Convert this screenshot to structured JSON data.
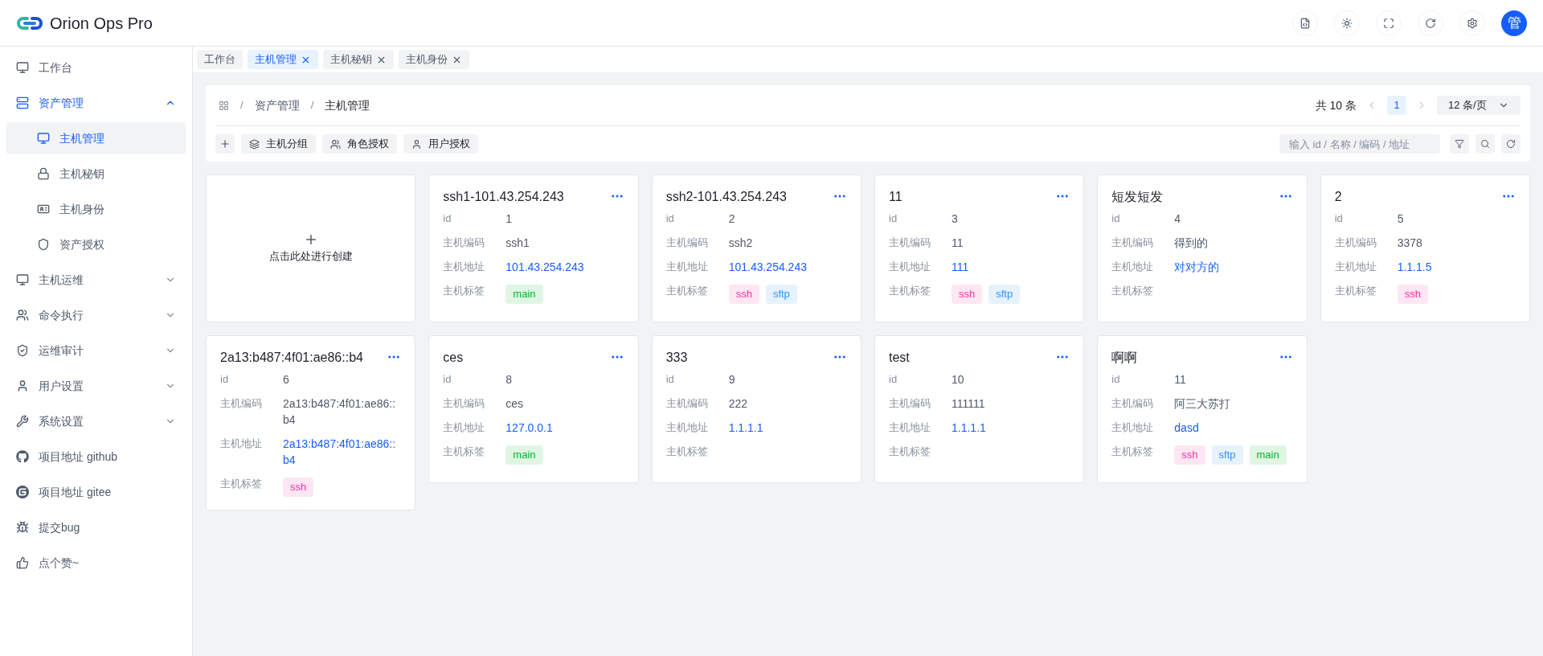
{
  "app": {
    "title": "Orion Ops Pro",
    "avatar": "管"
  },
  "sidebar": {
    "items": [
      {
        "label": "工作台",
        "selected": false
      },
      {
        "label": "资产管理",
        "selected": false,
        "expanded": true,
        "children": [
          {
            "label": "主机管理",
            "selected": true
          },
          {
            "label": "主机秘钥",
            "selected": false
          },
          {
            "label": "主机身份",
            "selected": false
          },
          {
            "label": "资产授权",
            "selected": false
          }
        ]
      },
      {
        "label": "主机运维",
        "selected": false,
        "expanded": false
      },
      {
        "label": "命令执行",
        "selected": false,
        "expanded": false
      },
      {
        "label": "运维审计",
        "selected": false,
        "expanded": false
      },
      {
        "label": "用户设置",
        "selected": false,
        "expanded": false
      },
      {
        "label": "系统设置",
        "selected": false,
        "expanded": false
      },
      {
        "label": "项目地址 github",
        "selected": false
      },
      {
        "label": "项目地址 gitee",
        "selected": false
      },
      {
        "label": "提交bug",
        "selected": false
      },
      {
        "label": "点个赞~",
        "selected": false
      }
    ]
  },
  "tabs": [
    {
      "label": "工作台",
      "selected": false,
      "closable": false
    },
    {
      "label": "主机管理",
      "selected": true,
      "closable": true
    },
    {
      "label": "主机秘钥",
      "selected": false,
      "closable": true
    },
    {
      "label": "主机身份",
      "selected": false,
      "closable": true
    }
  ],
  "breadcrumb": {
    "separator": "/",
    "items": [
      "资产管理",
      "主机管理"
    ]
  },
  "pagination": {
    "total": "共 10 条",
    "pages": [
      {
        "label": "1",
        "selected": true
      }
    ],
    "page_size": "12 条/页"
  },
  "toolbar": {
    "buttons": [
      "主机分组",
      "角色授权",
      "用户授权"
    ],
    "search": {
      "placeholder": "输入 id / 名称 / 编码 / 地址"
    }
  },
  "create_card": {
    "label": "点击此处进行创建"
  },
  "cards": [
    {
      "title": "ssh1-101.43.254.243",
      "fields": [
        {
          "kind": "text",
          "label": "id",
          "value": "1"
        },
        {
          "kind": "text",
          "label": "主机编码",
          "value": "ssh1"
        },
        {
          "kind": "link",
          "label": "主机地址",
          "value": "101.43.254.243"
        },
        {
          "kind": "tags",
          "label": "主机标签",
          "tags": [
            {
              "label": "main",
              "color": "#00b42a"
            }
          ]
        }
      ]
    },
    {
      "title": "ssh2-101.43.254.243",
      "fields": [
        {
          "kind": "text",
          "label": "id",
          "value": "2"
        },
        {
          "kind": "text",
          "label": "主机编码",
          "value": "ssh2"
        },
        {
          "kind": "link",
          "label": "主机地址",
          "value": "101.43.254.243"
        },
        {
          "kind": "tags",
          "label": "主机标签",
          "tags": [
            {
              "label": "ssh",
              "color": "#f5319d"
            },
            {
              "label": "sftp",
              "color": "#3491fa"
            }
          ]
        }
      ]
    },
    {
      "title": "11",
      "fields": [
        {
          "kind": "text",
          "label": "id",
          "value": "3"
        },
        {
          "kind": "text",
          "label": "主机编码",
          "value": "11"
        },
        {
          "kind": "link",
          "label": "主机地址",
          "value": "111"
        },
        {
          "kind": "tags",
          "label": "主机标签",
          "tags": [
            {
              "label": "ssh",
              "color": "#f5319d"
            },
            {
              "label": "sftp",
              "color": "#3491fa"
            }
          ]
        }
      ]
    },
    {
      "title": "短发短发",
      "fields": [
        {
          "kind": "text",
          "label": "id",
          "value": "4"
        },
        {
          "kind": "text",
          "label": "主机编码",
          "value": "得到的"
        },
        {
          "kind": "link",
          "label": "主机地址",
          "value": "对对方的"
        },
        {
          "kind": "tags",
          "label": "主机标签"
        }
      ]
    },
    {
      "title": "2",
      "fields": [
        {
          "kind": "text",
          "label": "id",
          "value": "5"
        },
        {
          "kind": "text",
          "label": "主机编码",
          "value": "3378"
        },
        {
          "kind": "link",
          "label": "主机地址",
          "value": "1.1.1.5"
        },
        {
          "kind": "tags",
          "label": "主机标签",
          "tags": [
            {
              "label": "ssh",
              "color": "#f5319d"
            }
          ]
        }
      ]
    },
    {
      "title": "2a13:b487:4f01:ae86::b4",
      "fields": [
        {
          "kind": "text",
          "label": "id",
          "value": "6"
        },
        {
          "kind": "text",
          "label": "主机编码",
          "value": "2a13:b487:4f01:ae86::b4"
        },
        {
          "kind": "link",
          "label": "主机地址",
          "value": "2a13:b487:4f01:ae86::b4"
        },
        {
          "kind": "tags",
          "label": "主机标签",
          "tags": [
            {
              "label": "ssh",
              "color": "#f5319d"
            }
          ]
        }
      ]
    },
    {
      "title": "ces",
      "fields": [
        {
          "kind": "text",
          "label": "id",
          "value": "8"
        },
        {
          "kind": "text",
          "label": "主机编码",
          "value": "ces"
        },
        {
          "kind": "link",
          "label": "主机地址",
          "value": "127.0.0.1"
        },
        {
          "kind": "tags",
          "label": "主机标签",
          "tags": [
            {
              "label": "main",
              "color": "#00b42a"
            }
          ]
        }
      ]
    },
    {
      "title": "333",
      "fields": [
        {
          "kind": "text",
          "label": "id",
          "value": "9"
        },
        {
          "kind": "text",
          "label": "主机编码",
          "value": "222"
        },
        {
          "kind": "link",
          "label": "主机地址",
          "value": "1.1.1.1"
        },
        {
          "kind": "tags",
          "label": "主机标签"
        }
      ]
    },
    {
      "title": "test",
      "fields": [
        {
          "kind": "text",
          "label": "id",
          "value": "10"
        },
        {
          "kind": "text",
          "label": "主机编码",
          "value": "111111"
        },
        {
          "kind": "link",
          "label": "主机地址",
          "value": "1.1.1.1"
        },
        {
          "kind": "tags",
          "label": "主机标签"
        }
      ]
    },
    {
      "title": "啊啊",
      "fields": [
        {
          "kind": "text",
          "label": "id",
          "value": "11"
        },
        {
          "kind": "text",
          "label": "主机编码",
          "value": "阿三大苏打"
        },
        {
          "kind": "link",
          "label": "主机地址",
          "value": "dasd"
        },
        {
          "kind": "tags",
          "label": "主机标签",
          "tags": [
            {
              "label": "ssh",
              "color": "#f5319d"
            },
            {
              "label": "sftp",
              "color": "#3491fa"
            },
            {
              "label": "main",
              "color": "#00b42a"
            }
          ]
        }
      ]
    }
  ]
}
